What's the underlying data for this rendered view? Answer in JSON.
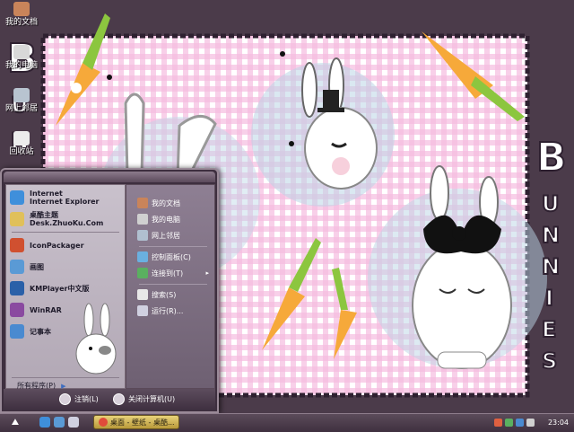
{
  "desktop_icons": [
    {
      "label": "我的文档",
      "icon": "folder-icon",
      "color": "#c9845a"
    },
    {
      "label": "我的电脑",
      "icon": "computer-icon",
      "color": "#d8d8d8"
    },
    {
      "label": "网上邻居",
      "icon": "network-icon",
      "color": "#b8c4d0"
    },
    {
      "label": "回收站",
      "icon": "recycle-bin-icon",
      "color": "#ececec"
    }
  ],
  "wallpaper": {
    "title_letters_right": "BUNNIES",
    "title_letters_left": "BUN",
    "colors": {
      "check_pink": "#f6bde0",
      "check_white": "#ffffff",
      "carrot": "#f6a93a",
      "leaf": "#8cc63f",
      "frame": "#2e2030",
      "star_blue": "#bcd6e6"
    }
  },
  "start_menu": {
    "pinned": [
      {
        "line1": "Internet",
        "line2": "Internet Explorer",
        "icon": "internet-explorer-icon",
        "color": "#3f8fdb"
      },
      {
        "line1": "桌酷主题",
        "line2": "Desk.ZhuoKu.Com",
        "icon": "theme-icon",
        "color": "#e0c05a"
      }
    ],
    "recent": [
      {
        "label": "IconPackager",
        "icon": "iconpackager-icon",
        "color": "#d05030"
      },
      {
        "label": "画图",
        "icon": "paint-icon",
        "color": "#5a9ad5"
      },
      {
        "label": "KMPlayer中文版",
        "icon": "kmplayer-icon",
        "color": "#2a60a8"
      },
      {
        "label": "WinRAR",
        "icon": "winrar-icon",
        "color": "#8a4aa0"
      },
      {
        "label": "记事本",
        "icon": "notepad-icon",
        "color": "#4a8ad0"
      }
    ],
    "all_programs": "所有程序(P)",
    "right_items": [
      {
        "label": "我的文档",
        "icon": "my-documents-icon",
        "color": "#c9845a",
        "arrow": ""
      },
      {
        "label": "我的电脑",
        "icon": "my-computer-icon",
        "color": "#d0d0d0",
        "arrow": ""
      },
      {
        "label": "网上邻居",
        "icon": "network-places-icon",
        "color": "#b0c0d0",
        "arrow": ""
      },
      {
        "label": "控制面板(C)",
        "icon": "control-panel-icon",
        "color": "#6ab0e0",
        "arrow": ""
      },
      {
        "label": "连接到(T)",
        "icon": "connect-to-icon",
        "color": "#5ab060",
        "arrow": "▸"
      },
      {
        "label": "搜索(S)",
        "icon": "search-icon",
        "color": "#e8e8e8",
        "arrow": ""
      },
      {
        "label": "运行(R)...",
        "icon": "run-icon",
        "color": "#d0d0e0",
        "arrow": ""
      }
    ],
    "logoff": "注销(L)",
    "shutdown": "关闭计算机(U)"
  },
  "taskbar": {
    "start_symbol": "⛰",
    "task_label": "桌面 - 壁纸 - 桌酷...",
    "clock": "23:04"
  }
}
